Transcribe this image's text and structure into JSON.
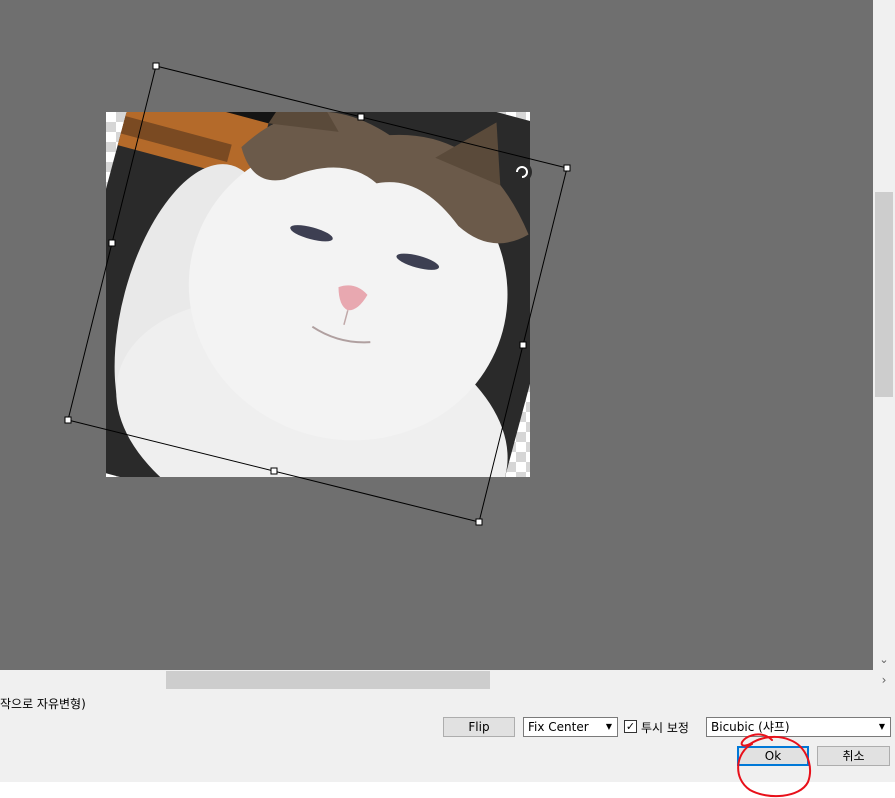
{
  "description_text": "작으로 자유변형)",
  "controls": {
    "flip_label": "Flip",
    "center_mode": {
      "selected": "Fix Center"
    },
    "perspective_checkbox": {
      "label": "투시 보정",
      "checked": true
    },
    "interpolation": {
      "selected": "Bicubic (샤프)"
    },
    "ok_label": "Ok",
    "cancel_label": "취소"
  },
  "icons": {
    "select_arrow": "▼",
    "check_mark": "✓",
    "scroll_down": "⌄",
    "scroll_right": "›"
  },
  "colors": {
    "canvas_bg": "#6f6f6f",
    "panel_bg": "#f0f0f0",
    "annotation_red": "#e8101a",
    "focus_blue": "#0078d7"
  }
}
